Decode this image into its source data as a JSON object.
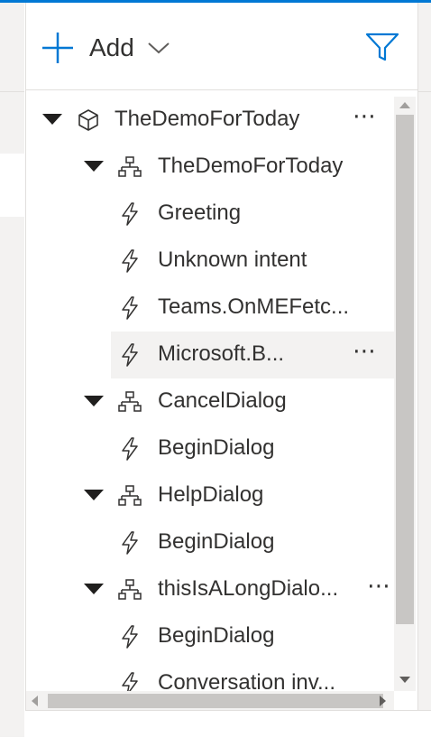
{
  "toolbar": {
    "add_label": "Add",
    "add_icon": "plus-icon",
    "dropdown_icon": "chevron-down-icon",
    "filter_icon": "filter-icon",
    "accent_color": "#0078d4"
  },
  "tree": {
    "items": [
      {
        "label": "TheDemoForToday",
        "kind": "bot",
        "icon": "cube-icon",
        "expanded": true,
        "level": 0,
        "more": "⋯"
      },
      {
        "label": "TheDemoForToday",
        "kind": "dialog",
        "icon": "org-chart-icon",
        "expanded": true,
        "level": 1,
        "more": ""
      },
      {
        "label": "Greeting",
        "kind": "trigger",
        "icon": "lightning-icon",
        "level": 2,
        "more": ""
      },
      {
        "label": "Unknown intent",
        "kind": "trigger",
        "icon": "lightning-icon",
        "level": 2,
        "more": ""
      },
      {
        "label": "Teams.OnMEFetc...",
        "kind": "trigger",
        "icon": "lightning-icon",
        "level": 2,
        "more": ""
      },
      {
        "label": "Microsoft.B...",
        "kind": "trigger",
        "icon": "lightning-icon",
        "level": 2,
        "selected": true,
        "more": "⋯"
      },
      {
        "label": "CancelDialog",
        "kind": "dialog",
        "icon": "org-chart-icon",
        "expanded": true,
        "level": 1,
        "more": ""
      },
      {
        "label": "BeginDialog",
        "kind": "trigger",
        "icon": "lightning-icon",
        "level": 2,
        "more": ""
      },
      {
        "label": "HelpDialog",
        "kind": "dialog",
        "icon": "org-chart-icon",
        "expanded": true,
        "level": 1,
        "more": ""
      },
      {
        "label": "BeginDialog",
        "kind": "trigger",
        "icon": "lightning-icon",
        "level": 2,
        "more": ""
      },
      {
        "label": "thisIsALongDialo...",
        "kind": "dialog",
        "icon": "org-chart-icon",
        "expanded": true,
        "level": 1,
        "more": "⋯"
      },
      {
        "label": "BeginDialog",
        "kind": "trigger",
        "icon": "lightning-icon",
        "level": 2,
        "more": ""
      },
      {
        "label": "Conversation inv...",
        "kind": "trigger",
        "icon": "lightning-icon",
        "level": 2,
        "more": ""
      }
    ]
  }
}
